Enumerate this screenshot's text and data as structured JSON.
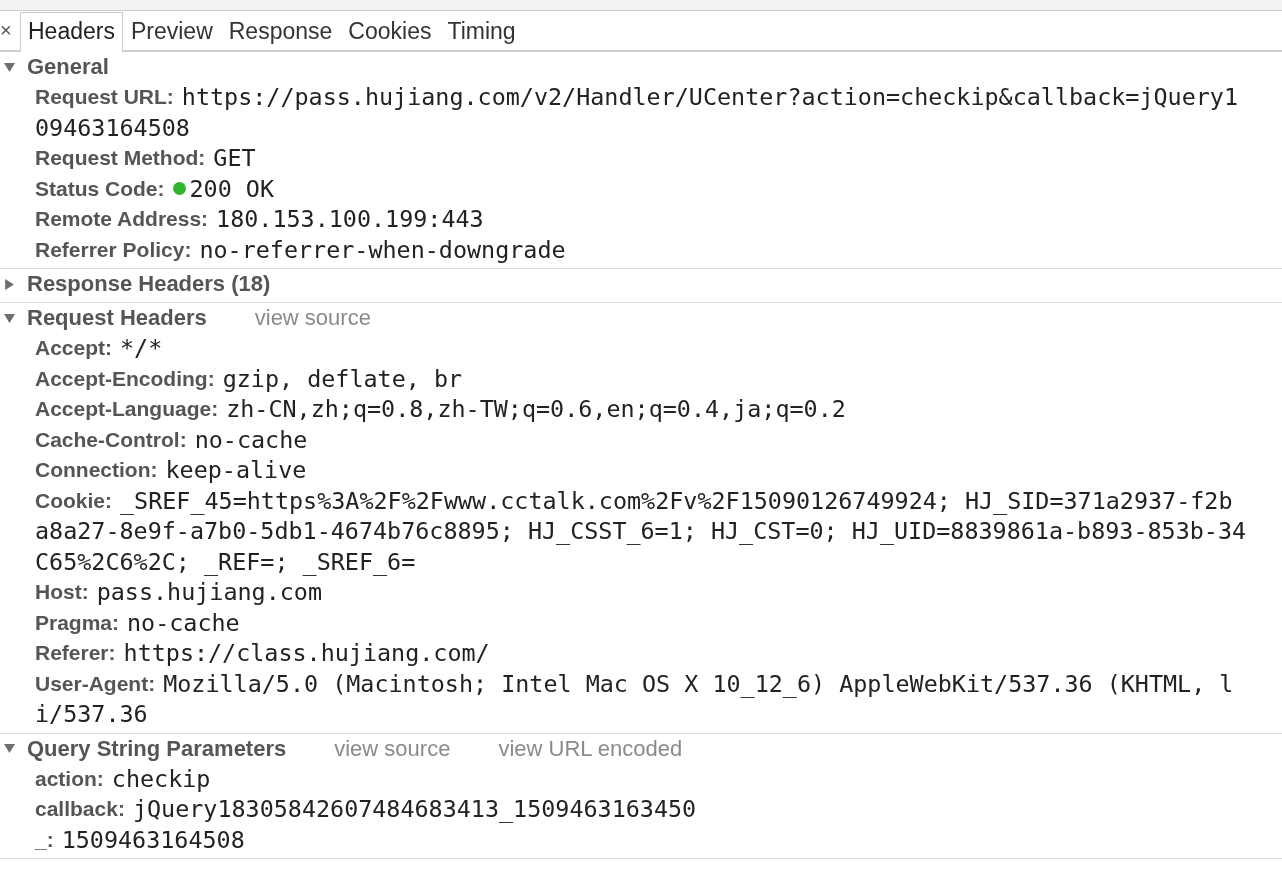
{
  "close_button": "×",
  "tabs": [
    {
      "label": "Headers",
      "selected": true
    },
    {
      "label": "Preview",
      "selected": false
    },
    {
      "label": "Response",
      "selected": false
    },
    {
      "label": "Cookies",
      "selected": false
    },
    {
      "label": "Timing",
      "selected": false
    }
  ],
  "sections": [
    {
      "title": "General",
      "expanded": true,
      "rows": [
        {
          "name": "Request URL:",
          "lines": [
            "https://pass.hujiang.com/v2/Handler/UCenter?action=checkip&callback=jQuery1",
            "09463164508"
          ]
        },
        {
          "name": "Request Method:",
          "lines": [
            "GET"
          ]
        },
        {
          "name": "Status Code:",
          "lines": [
            "200 OK"
          ],
          "color": "#2fb62f"
        },
        {
          "name": "Remote Address:",
          "lines": [
            "180.153.100.199:443"
          ]
        },
        {
          "name": "Referrer Policy:",
          "lines": [
            "no-referrer-when-downgrade"
          ]
        }
      ]
    },
    {
      "title": "Response Headers (18)",
      "expanded": false
    },
    {
      "title": "Request Headers",
      "expanded": true,
      "links": [
        "view source"
      ],
      "rows": [
        {
          "name": "Accept:",
          "lines": [
            "*/*"
          ]
        },
        {
          "name": "Accept-Encoding:",
          "lines": [
            "gzip, deflate, br"
          ]
        },
        {
          "name": "Accept-Language:",
          "lines": [
            "zh-CN,zh;q=0.8,zh-TW;q=0.6,en;q=0.4,ja;q=0.2"
          ]
        },
        {
          "name": "Cache-Control:",
          "lines": [
            "no-cache"
          ]
        },
        {
          "name": "Connection:",
          "lines": [
            "keep-alive"
          ]
        },
        {
          "name": "Cookie:",
          "lines": [
            "_SREF_45=https%3A%2F%2Fwww.cctalk.com%2Fv%2F15090126749924; HJ_SID=371a2937-f2b",
            "a8a27-8e9f-a7b0-5db1-4674b76c8895; HJ_CSST_6=1; HJ_CST=0; HJ_UID=8839861a-b893-853b-34",
            "C65%2C6%2C; _REF=; _SREF_6="
          ]
        },
        {
          "name": "Host:",
          "lines": [
            "pass.hujiang.com"
          ]
        },
        {
          "name": "Pragma:",
          "lines": [
            "no-cache"
          ]
        },
        {
          "name": "Referer:",
          "lines": [
            "https://class.hujiang.com/"
          ]
        },
        {
          "name": "User-Agent:",
          "lines": [
            "Mozilla/5.0 (Macintosh; Intel Mac OS X 10_12_6) AppleWebKit/537.36 (KHTML, l",
            "i/537.36"
          ]
        }
      ]
    },
    {
      "title": "Query String Parameters",
      "expanded": true,
      "links": [
        "view source",
        "view URL encoded"
      ],
      "rows": [
        {
          "name": "action:",
          "lines": [
            "checkip"
          ]
        },
        {
          "name": "callback:",
          "lines": [
            "jQuery18305842607484683413_1509463163450"
          ]
        },
        {
          "name": "_:",
          "lines": [
            "1509463164508"
          ]
        }
      ]
    }
  ]
}
